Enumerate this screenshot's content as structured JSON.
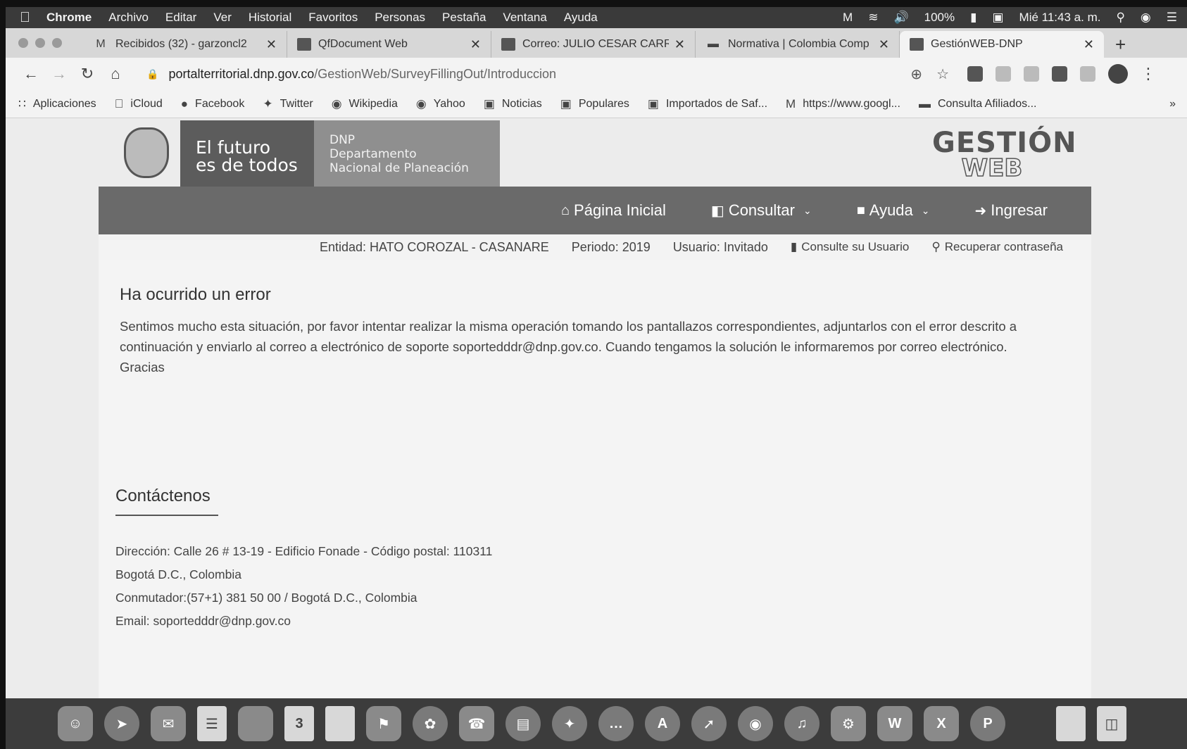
{
  "menubar": {
    "app": "Chrome",
    "items": [
      "Archivo",
      "Editar",
      "Ver",
      "Historial",
      "Favoritos",
      "Personas",
      "Pestaña",
      "Ventana",
      "Ayuda"
    ],
    "battery": "100%",
    "clock": "Mié 11:43 a. m."
  },
  "tabs": [
    {
      "label": "Recibidos (32) - garzoncl2",
      "icon": "gmail-icon"
    },
    {
      "label": "QfDocument Web",
      "icon": "qfdocument-icon"
    },
    {
      "label": "Correo: JULIO CESAR CARR",
      "icon": "outlook-icon"
    },
    {
      "label": "Normativa | Colombia Comp",
      "icon": "colombia-compra-icon"
    },
    {
      "label": "GestiónWEB-DNP",
      "icon": "dnp-icon"
    }
  ],
  "address": {
    "domain": "portalterritorial.dnp.gov.co",
    "path": "/GestionWeb/SurveyFillingOut/Introduccion"
  },
  "bookmarks": [
    {
      "label": "Aplicaciones",
      "icon": "apps-grid-icon"
    },
    {
      "label": "iCloud",
      "icon": "apple-icon"
    },
    {
      "label": "Facebook",
      "icon": "facebook-icon"
    },
    {
      "label": "Twitter",
      "icon": "twitter-icon"
    },
    {
      "label": "Wikipedia",
      "icon": "globe-icon"
    },
    {
      "label": "Yahoo",
      "icon": "globe-icon"
    },
    {
      "label": "Noticias",
      "icon": "folder-icon"
    },
    {
      "label": "Populares",
      "icon": "folder-icon"
    },
    {
      "label": "Importados de Saf...",
      "icon": "folder-icon"
    },
    {
      "label": "https://www.googl...",
      "icon": "gmail-icon"
    },
    {
      "label": "Consulta Afiliados...",
      "icon": "site-icon"
    }
  ],
  "brand": {
    "slogan_line1": "El futuro",
    "slogan_line2": "es de todos",
    "dnp_line1": "DNP",
    "dnp_line2": "Departamento",
    "dnp_line3": "Nacional de Planeación",
    "logo_line1": "GESTIÓN",
    "logo_line2": "WEB"
  },
  "nav": {
    "home": "Página Inicial",
    "consultar": "Consultar",
    "ayuda": "Ayuda",
    "ingresar": "Ingresar"
  },
  "info": {
    "entidad": "Entidad: HATO COROZAL - CASANARE",
    "periodo": "Periodo: 2019",
    "usuario": "Usuario: Invitado",
    "consulte": "Consulte su Usuario",
    "recuperar": "Recuperar contraseña"
  },
  "error": {
    "title": "Ha ocurrido un error",
    "message": "Sentimos mucho esta situación, por favor intentar realizar la misma operación tomando los pantallazos correspondientes, adjuntarlos con el error descrito a continuación y enviarlo al correo a electrónico de soporte soportedddr@dnp.gov.co. Cuando tengamos la solución le informaremos por correo electrónico. Gracias"
  },
  "contact": {
    "title": "Contáctenos",
    "direccion": "Dirección: Calle 26 # 13-19 - Edificio Fonade - Código postal: 110311",
    "ciudad": "Bogotá D.C., Colombia",
    "conmutador": "Conmutador:(57+1) 381 50 00 / Bogotá D.C., Colombia",
    "email": "Email: soportedddr@dnp.gov.co"
  },
  "dock": {
    "calendar_day": "3",
    "word": "W",
    "excel": "X",
    "powerpoint": "P"
  }
}
